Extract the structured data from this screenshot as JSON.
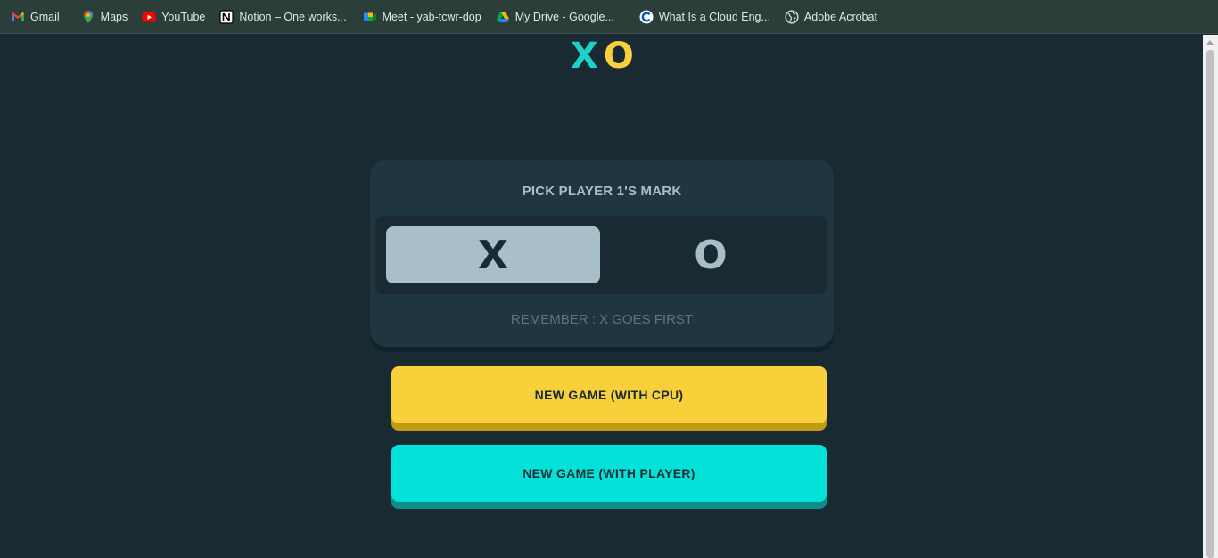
{
  "bookmarks": [
    {
      "label": "Gmail",
      "icon": "gmail-icon"
    },
    {
      "label": "Maps",
      "icon": "maps-icon"
    },
    {
      "label": "YouTube",
      "icon": "youtube-icon"
    },
    {
      "label": "Notion – One works...",
      "icon": "notion-icon"
    },
    {
      "label": "Meet - yab-tcwr-dop",
      "icon": "meet-icon"
    },
    {
      "label": "My Drive - Google...",
      "icon": "drive-icon"
    },
    {
      "label": "What Is a Cloud Eng...",
      "icon": "coursera-icon"
    },
    {
      "label": "Adobe Acrobat",
      "icon": "globe-icon"
    }
  ],
  "logo": {
    "x": "X",
    "o": "O"
  },
  "pick": {
    "title": "PICK PLAYER 1'S MARK",
    "options": [
      "X",
      "O"
    ],
    "selected": "X",
    "hint": "REMEMBER : X GOES FIRST"
  },
  "buttons": {
    "cpu": "NEW GAME (WITH CPU)",
    "player": "NEW GAME (WITH PLAYER)"
  },
  "colors": {
    "background": "#1a2a33",
    "card": "#1f3641",
    "teal": "#1fd0c6",
    "yellow": "#f8d03a",
    "silver": "#a8bfc9"
  }
}
